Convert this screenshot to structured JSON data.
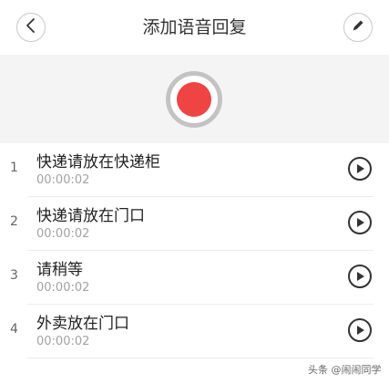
{
  "header": {
    "title": "添加语音回复",
    "back_icon": "chevron-left-icon",
    "edit_icon": "pencil-icon"
  },
  "recorder": {
    "icon": "record-icon",
    "accent_color": "#ee4444"
  },
  "replies": [
    {
      "index": "1",
      "title": "快递请放在快递柜",
      "duration": "00:00:02"
    },
    {
      "index": "2",
      "title": "快递请放在门口",
      "duration": "00:00:02"
    },
    {
      "index": "3",
      "title": "请稍等",
      "duration": "00:00:02"
    },
    {
      "index": "4",
      "title": "外卖放在门口",
      "duration": "00:00:02"
    }
  ],
  "watermark": "头条 @闹闹同学"
}
